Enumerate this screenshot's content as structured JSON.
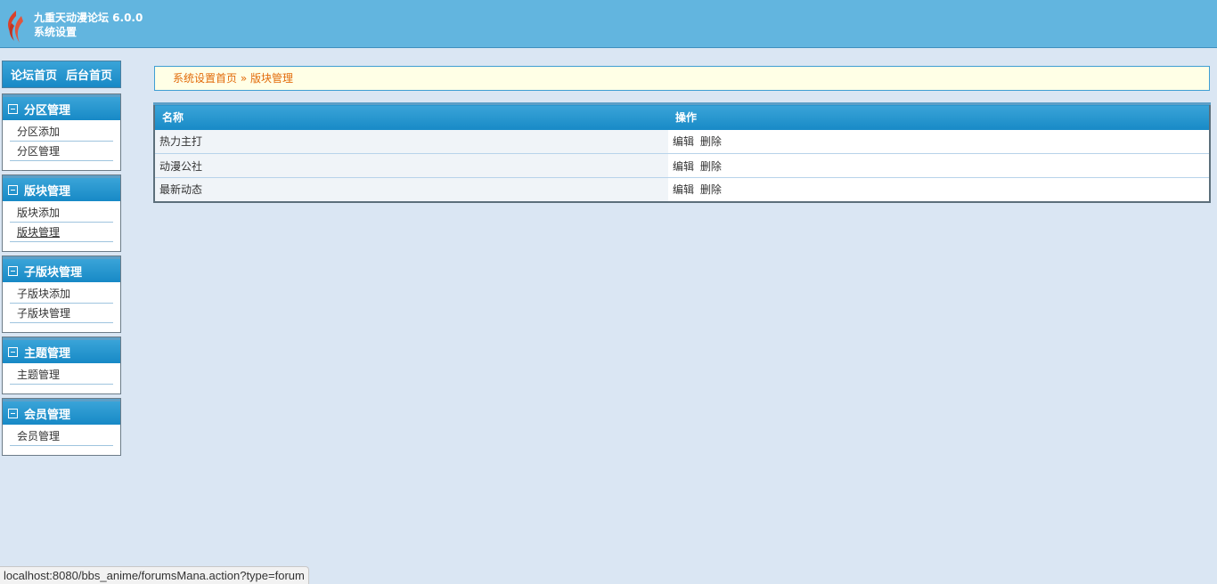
{
  "header": {
    "app_title": "九重天动漫论坛 6.0.0",
    "subtitle": "系统设置"
  },
  "topnav": {
    "forum_home": "论坛首页",
    "admin_home": "后台首页"
  },
  "sidebar": {
    "groups": [
      {
        "title": "分区管理",
        "items": [
          "分区添加",
          "分区管理"
        ]
      },
      {
        "title": "版块管理",
        "items": [
          "版块添加",
          "版块管理"
        ]
      },
      {
        "title": "子版块管理",
        "items": [
          "子版块添加",
          "子版块管理"
        ]
      },
      {
        "title": "主题管理",
        "items": [
          "主题管理"
        ]
      },
      {
        "title": "会员管理",
        "items": [
          "会员管理"
        ]
      }
    ]
  },
  "breadcrumb": {
    "home": "系统设置首页",
    "separator": "»",
    "current": "版块管理"
  },
  "table": {
    "headers": [
      "名称",
      "操作"
    ],
    "rows": [
      {
        "name": "热力主打",
        "edit": "编辑",
        "delete": "删除"
      },
      {
        "name": "动漫公社",
        "edit": "编辑",
        "delete": "删除"
      },
      {
        "name": "最新动态",
        "edit": "编辑",
        "delete": "删除"
      }
    ]
  },
  "statusbar": {
    "url": "localhost:8080/bbs_anime/forumsMana.action?type=forum"
  },
  "colors": {
    "header_bg": "#62b5df",
    "page_bg": "#dae6f3",
    "menu_head": "#1789c6",
    "breadcrumb_text": "#e26b0a",
    "breadcrumb_bg": "#ffffe6"
  }
}
